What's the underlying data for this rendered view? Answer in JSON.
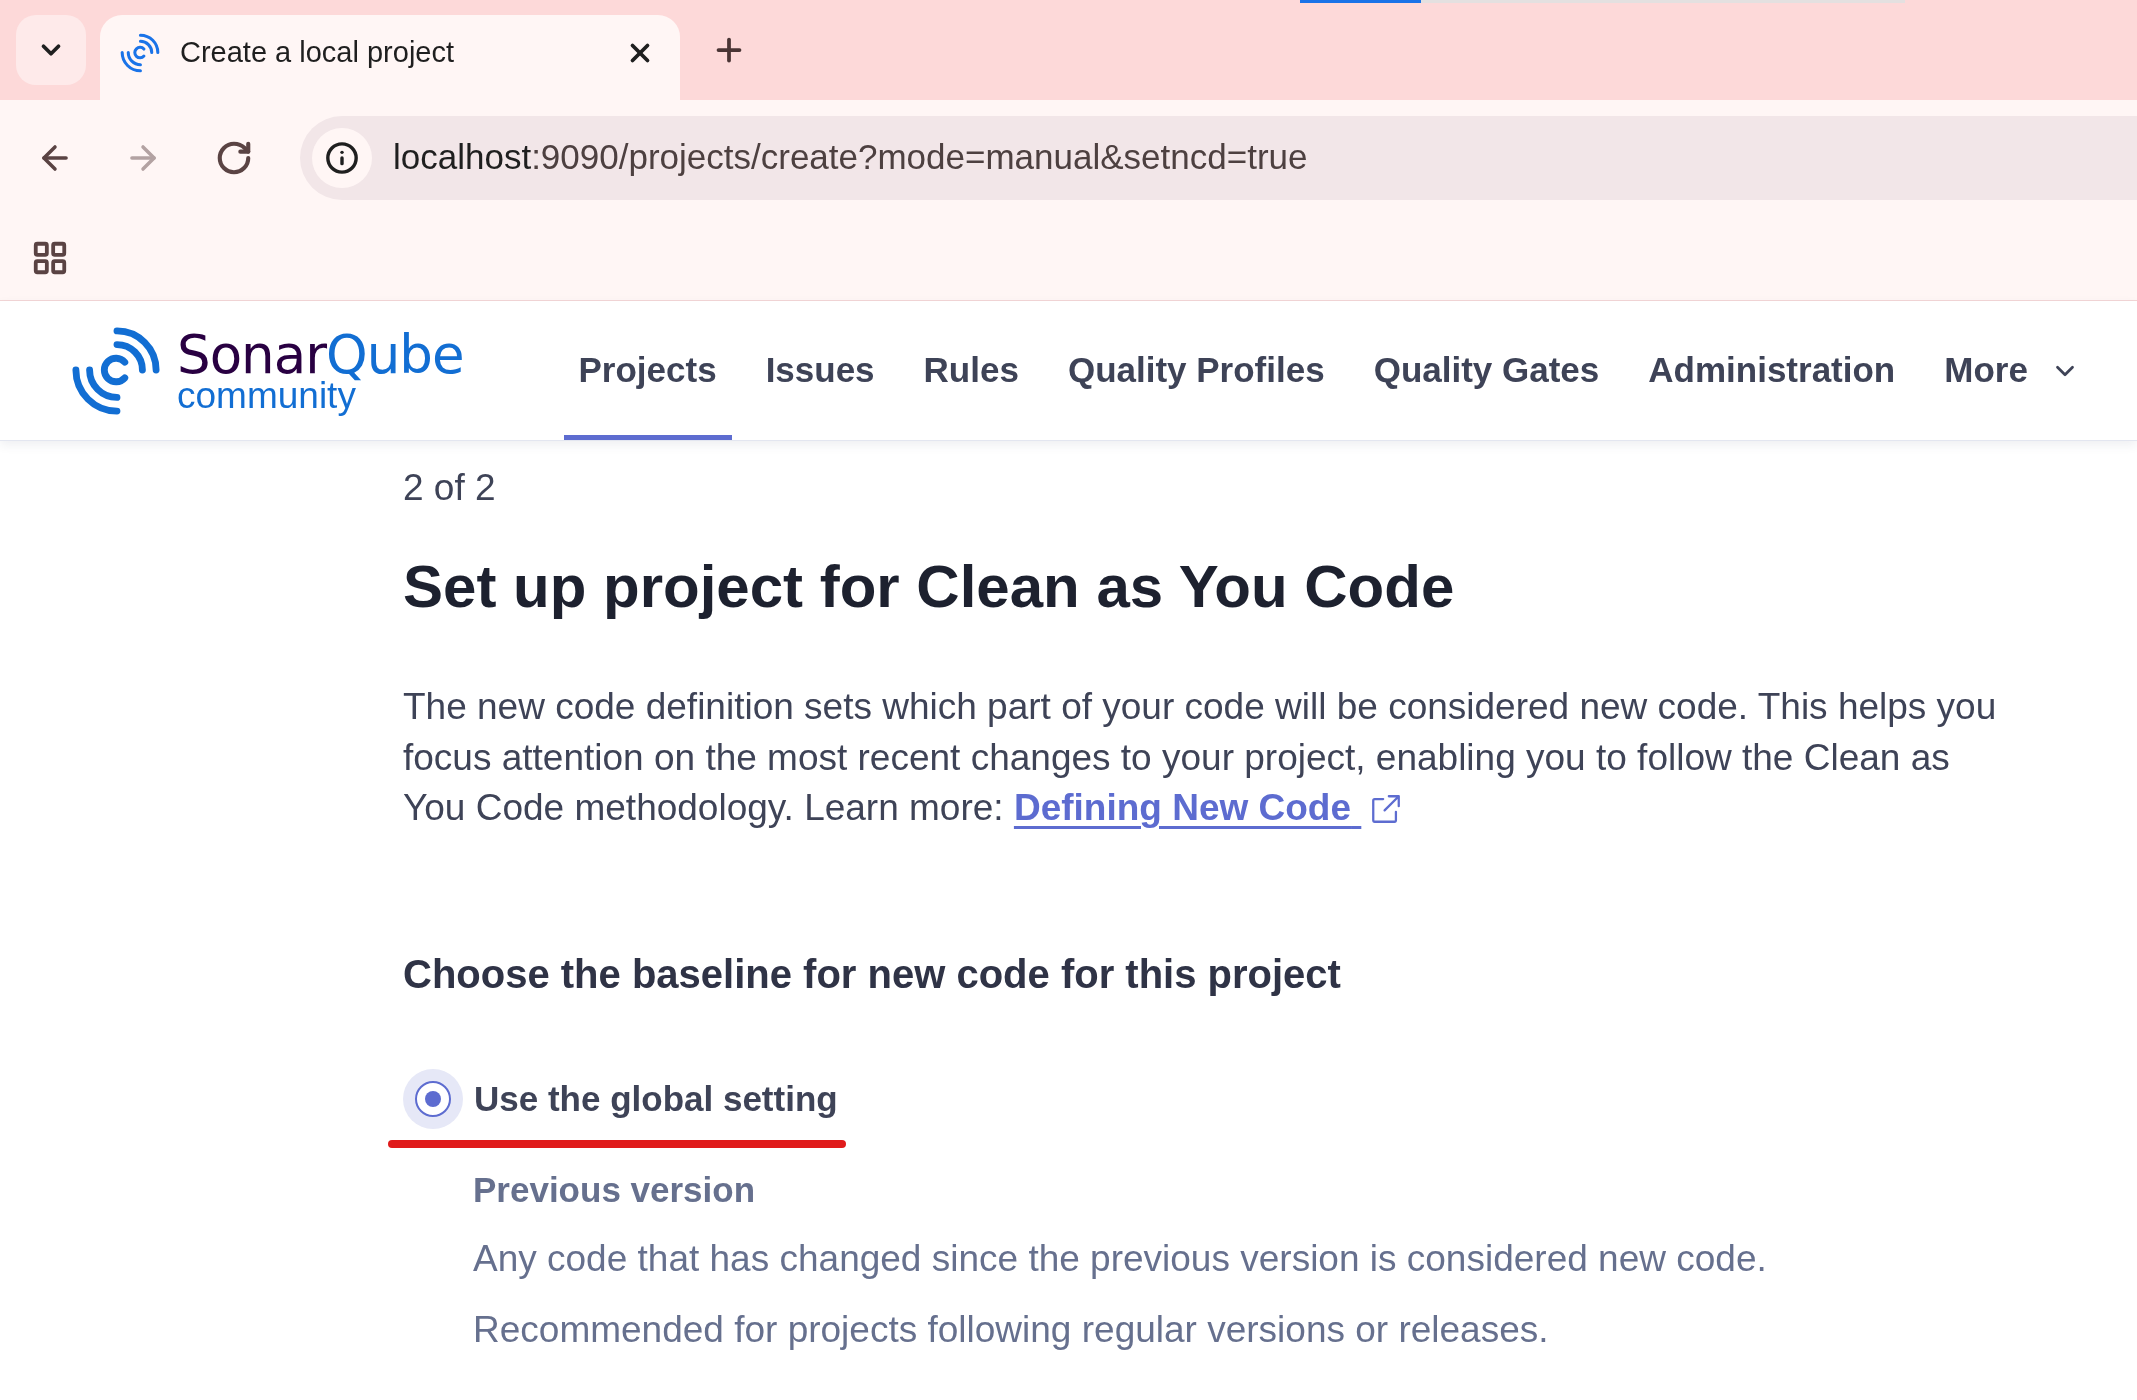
{
  "browser": {
    "loading_bar": {
      "level": 0.2
    },
    "tabs": [
      {
        "title": "Create a local project",
        "selected": true
      }
    ],
    "nav_buttons": [
      {
        "kind": "back",
        "disabled": false
      },
      {
        "kind": "forward",
        "disabled": true
      },
      {
        "kind": "reload",
        "disabled": false
      }
    ],
    "address_bar": {
      "host": "localhost",
      "path": ":9090/projects/create?mode=manual&setncd=true"
    }
  },
  "app_header": {
    "logo": {
      "wordmark": [
        {
          "text": "Sonar",
          "color": "#290042"
        },
        {
          "text": "Qube",
          "color": "#126ed3"
        }
      ],
      "edition": "community"
    },
    "nav": [
      {
        "label": "Projects",
        "selected": true,
        "kind": "link"
      },
      {
        "label": "Issues",
        "selected": false,
        "kind": "link"
      },
      {
        "label": "Rules",
        "selected": false,
        "kind": "link"
      },
      {
        "label": "Quality Profiles",
        "selected": false,
        "kind": "link"
      },
      {
        "label": "Quality Gates",
        "selected": false,
        "kind": "link"
      },
      {
        "label": "Administration",
        "selected": false,
        "kind": "link"
      },
      {
        "label": "More",
        "selected": false,
        "kind": "menu"
      }
    ]
  },
  "page": {
    "step": "2 of 2",
    "title": "Set up project for Clean as You Code",
    "description": "The new code definition sets which part of your code will be considered new code. This helps you focus attention on the most recent changes to your project, enabling you to follow the Clean as You Code methodology. Learn more:",
    "learn_more_link": "Defining New Code",
    "baseline_heading": "Choose the baseline for new code for this project",
    "options": [
      {
        "label": "Use the global setting",
        "selected": true,
        "highlighted": true,
        "setting": {
          "name": "Previous version",
          "details": [
            "Any code that has changed since the previous version is considered new code.",
            "Recommended for projects following regular versions or releases."
          ]
        }
      }
    ]
  }
}
